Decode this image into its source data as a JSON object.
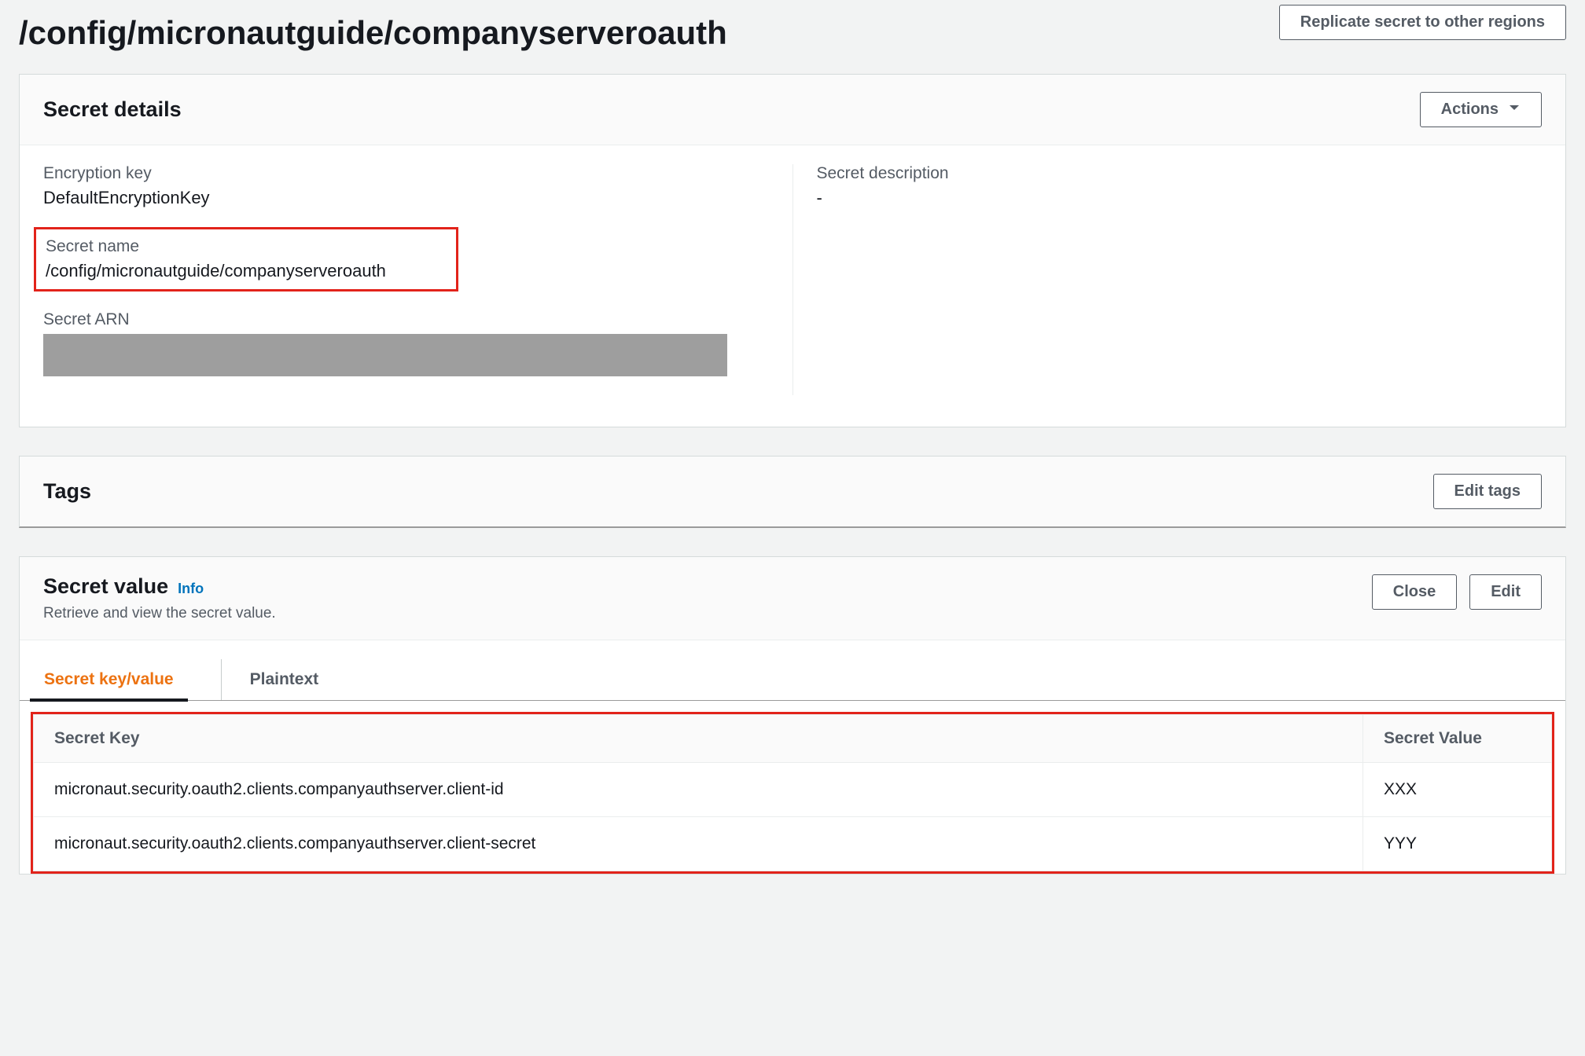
{
  "header": {
    "title": "/config/micronautguide/companyserveroauth",
    "replicate_button": "Replicate secret to other regions"
  },
  "secret_details": {
    "panel_title": "Secret details",
    "actions_button": "Actions",
    "encryption_key_label": "Encryption key",
    "encryption_key_value": "DefaultEncryptionKey",
    "secret_name_label": "Secret name",
    "secret_name_value": "/config/micronautguide/companyserveroauth",
    "secret_arn_label": "Secret ARN",
    "secret_description_label": "Secret description",
    "secret_description_value": "-"
  },
  "tags": {
    "panel_title": "Tags",
    "edit_button": "Edit tags"
  },
  "secret_value": {
    "panel_title": "Secret value",
    "info_link": "Info",
    "description": "Retrieve and view the secret value.",
    "close_button": "Close",
    "edit_button": "Edit",
    "tabs": {
      "keyvalue": "Secret key/value",
      "plaintext": "Plaintext"
    },
    "table": {
      "col_key": "Secret Key",
      "col_value": "Secret Value",
      "rows": [
        {
          "key": "micronaut.security.oauth2.clients.companyauthserver.client-id",
          "value": "XXX"
        },
        {
          "key": "micronaut.security.oauth2.clients.companyauthserver.client-secret",
          "value": "YYY"
        }
      ]
    }
  }
}
